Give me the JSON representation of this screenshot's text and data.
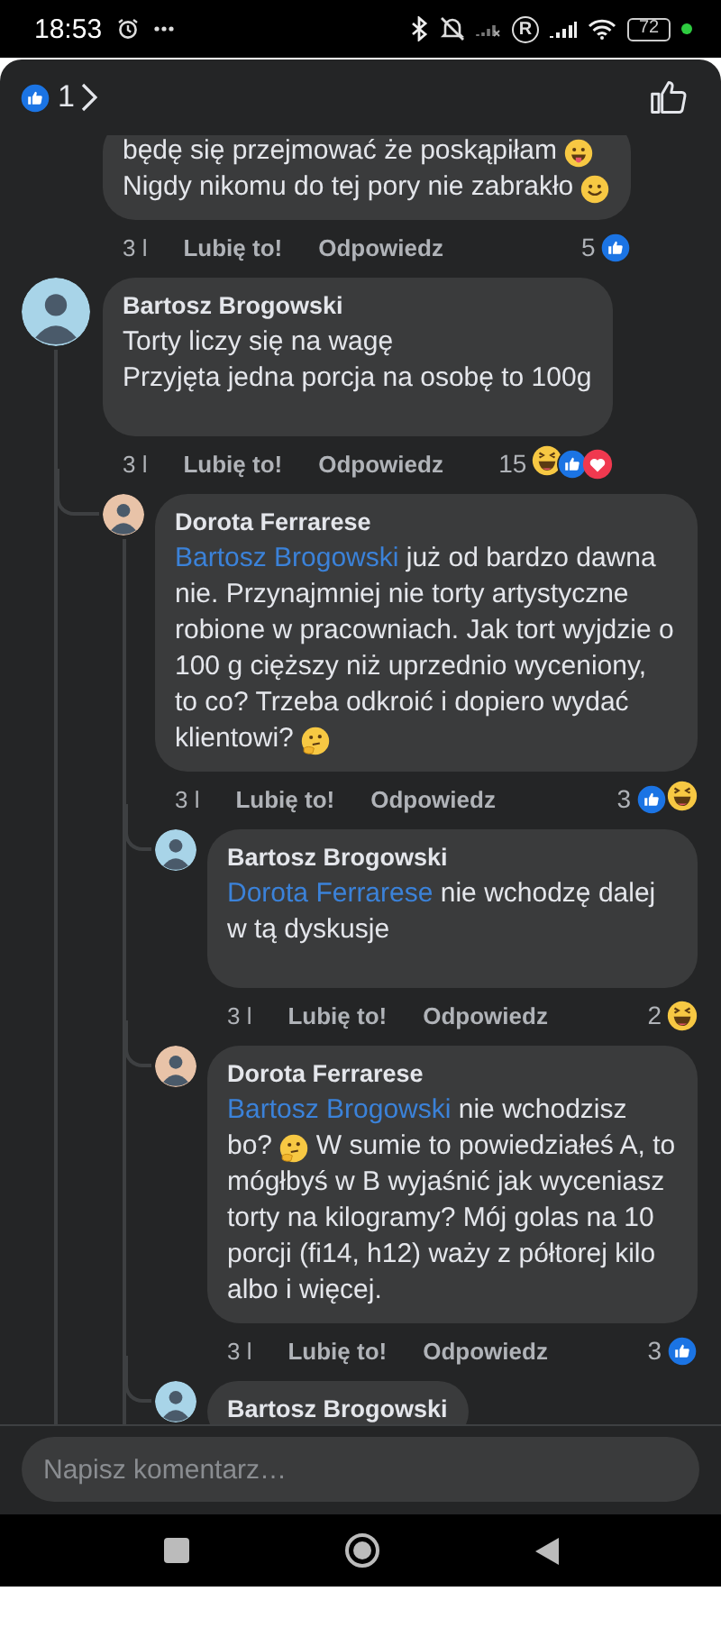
{
  "status_bar": {
    "time": "18:53",
    "roaming": "R",
    "battery": "72"
  },
  "header": {
    "reaction_count": "1"
  },
  "comments": [
    {
      "segments": [
        {
          "kind": "text",
          "text": "będę się przejmować że poskąpiłam "
        },
        {
          "kind": "tongue"
        },
        {
          "kind": "break"
        },
        {
          "kind": "text",
          "text": "Nigdy nikomu do tej pory nie zabrakło "
        },
        {
          "kind": "smile"
        }
      ],
      "time": "3 l",
      "like": "Lubię to!",
      "reply": "Odpowiedz",
      "reaction_count": "5",
      "reactions": [
        {
          "kind": "like"
        }
      ]
    },
    {
      "author": "Bartosz Brogowski",
      "avatar": {
        "color": "#a8d4e8"
      },
      "segments": [
        {
          "kind": "text",
          "text": "Torty liczy się na wagę"
        },
        {
          "kind": "break"
        },
        {
          "kind": "text",
          "text": "Przyjęta jedna porcja na osobę to 100g"
        }
      ],
      "time": "3 l",
      "like": "Lubię to!",
      "reply": "Odpowiedz",
      "reaction_count": "15",
      "reactions": [
        {
          "kind": "haha"
        },
        {
          "kind": "like"
        },
        {
          "kind": "love"
        }
      ],
      "children": [
        {
          "author": "Dorota Ferrarese",
          "avatar": {
            "color": "#e8c3a8"
          },
          "segments": [
            {
              "kind": "mention",
              "text": "Bartosz Brogowski"
            },
            {
              "kind": "text",
              "text": " już od bardzo dawna nie. Przynajmniej nie torty artystyczne robione w pracowniach. Jak tort wyjdzie o 100 g cięższy niż uprzednio wyceniony, to co? Trzeba odkroić i dopiero wydać klientowi? "
            },
            {
              "kind": "thinking"
            }
          ],
          "time": "3 l",
          "like": "Lubię to!",
          "reply": "Odpowiedz",
          "reaction_count": "3",
          "reactions": [
            {
              "kind": "like"
            },
            {
              "kind": "haha"
            }
          ],
          "children": [
            {
              "author": "Bartosz Brogowski",
              "avatar": {
                "color": "#a8d4e8"
              },
              "segments": [
                {
                  "kind": "mention",
                  "text": "Dorota Ferrarese"
                },
                {
                  "kind": "text",
                  "text": " nie wchodzę dalej w tą dyskusje"
                }
              ],
              "time": "3 l",
              "like": "Lubię to!",
              "reply": "Odpowiedz",
              "reaction_count": "2",
              "reactions": [
                {
                  "kind": "haha"
                }
              ]
            },
            {
              "author": "Dorota Ferrarese",
              "avatar": {
                "color": "#e8c3a8"
              },
              "segments": [
                {
                  "kind": "mention",
                  "text": "Bartosz Brogowski"
                },
                {
                  "kind": "text",
                  "text": "  nie wchodzisz bo? "
                },
                {
                  "kind": "thinking"
                },
                {
                  "kind": "text",
                  "text": " W sumie to powiedziałeś A, to mógłbyś w B wyjaśnić jak wyceniasz torty na kilogramy? Mój golas na 10 porcji (fi14, h12) waży z półtorej kilo albo i więcej."
                }
              ],
              "time": "3 l",
              "like": "Lubię to!",
              "reply": "Odpowiedz",
              "reaction_count": "3",
              "reactions": [
                {
                  "kind": "like"
                }
              ]
            },
            {
              "author": "Bartosz Brogowski",
              "avatar": {
                "color": "#a8d4e8"
              }
            }
          ]
        }
      ]
    }
  ],
  "composer": {
    "placeholder": "Napisz komentarz…"
  }
}
